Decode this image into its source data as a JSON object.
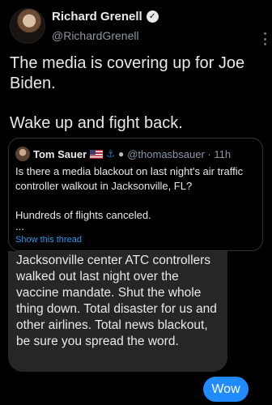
{
  "author": {
    "name": "Richard Grenell",
    "handle": "@RichardGrenell",
    "verified_mark": "✓"
  },
  "tweet": {
    "line1": "The media is covering up for Joe Biden.",
    "line2": "Wake up and fight back."
  },
  "quoted": {
    "name": "Tom Sauer",
    "handle_time": "@thomasbsauer · 11h",
    "icons": [
      "us-flag-icon",
      "anchor-icon",
      "bomb-icon"
    ],
    "text1": "Is there a media blackout on last night's air traffic controller walkout in Jacksonville, FL?",
    "text2": "Hundreds of flights canceled.",
    "ellipsis": "...",
    "show_thread": "Show this thread"
  },
  "chat": {
    "incoming": "Jacksonville center ATC controllers walked out last night over the vaccine mandate. Shut the whole thing down. Total disaster for us and other airlines. Total news blackout, be sure you spread the word.",
    "outgoing": "Wow"
  },
  "colors": {
    "background": "#000000",
    "link": "#1d9bf0",
    "incoming_bubble": "#262628",
    "outgoing_bubble": "#1f8bff"
  }
}
